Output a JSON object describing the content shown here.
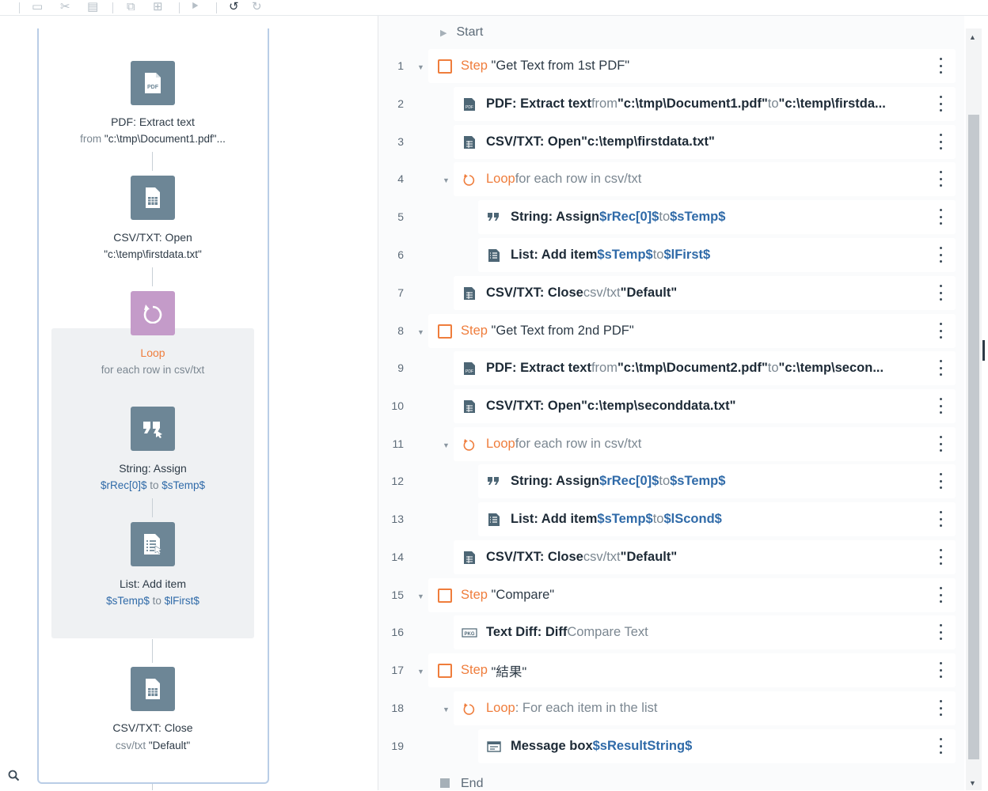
{
  "toolbar": {
    "icons": [
      "new-icon",
      "cut-icon",
      "delete-icon",
      "copy-icon",
      "paste-icon",
      "run-icon",
      "undo-icon",
      "redo-icon"
    ]
  },
  "flow": {
    "nodes": [
      {
        "id": "pdf",
        "icon": "pdf-icon",
        "title": "PDF: Extract text",
        "sub_prefix": "from ",
        "sub_value": "\"c:\\tmp\\Document1.pdf\"..."
      },
      {
        "id": "csv-open",
        "icon": "file-icon",
        "title": "CSV/TXT: Open",
        "sub_value": "\"c:\\temp\\firstdata.txt\""
      },
      {
        "id": "loop",
        "icon": "loop-icon",
        "title": "Loop",
        "sub": "for each row in csv/txt"
      },
      {
        "id": "string-assign",
        "icon": "quote-icon",
        "title": "String: Assign",
        "sub_a": "$rRec[0]$",
        "sub_to": " to ",
        "sub_b": "$sTemp$"
      },
      {
        "id": "list-add",
        "icon": "list-icon",
        "title": "List: Add item",
        "sub_a": "$sTemp$",
        "sub_to": " to ",
        "sub_b": "$lFirst$"
      },
      {
        "id": "csv-close",
        "icon": "file-icon",
        "title": "CSV/TXT: Close",
        "sub_prefix": "csv/txt ",
        "sub_value": "\"Default\""
      }
    ]
  },
  "list": {
    "start_label": "Start",
    "end_label": "End",
    "rows": [
      {
        "n": "1",
        "kw": "Step",
        "text": "\"Get Text from 1st PDF\""
      },
      {
        "n": "2",
        "kw": "PDF: Extract text",
        "from": " from ",
        "src": "\"c:\\tmp\\Document1.pdf\"",
        "to": " to ",
        "dst": "\"c:\\temp\\firstda..."
      },
      {
        "n": "3",
        "kw": "CSV/TXT: Open",
        "src": " \"c:\\temp\\firstdata.txt\""
      },
      {
        "n": "4",
        "kw": "Loop",
        "text": " for each row in csv/txt"
      },
      {
        "n": "5",
        "kw": "String: Assign",
        "a": " $rRec[0]$",
        "to": " to ",
        "b": "$sTemp$"
      },
      {
        "n": "6",
        "kw": "List: Add item",
        "a": " $sTemp$",
        "to": " to ",
        "b": "$lFirst$"
      },
      {
        "n": "7",
        "kw": "CSV/TXT: Close",
        "mid": " csv/txt ",
        "val": "\"Default\""
      },
      {
        "n": "8",
        "kw": "Step",
        "text": "\"Get Text from 2nd PDF\""
      },
      {
        "n": "9",
        "kw": "PDF: Extract text",
        "from": " from ",
        "src": "\"c:\\tmp\\Document2.pdf\"",
        "to": " to ",
        "dst": "\"c:\\temp\\secon..."
      },
      {
        "n": "10",
        "kw": "CSV/TXT: Open",
        "src": " \"c:\\temp\\seconddata.txt\""
      },
      {
        "n": "11",
        "kw": "Loop",
        "text": " for each row in csv/txt"
      },
      {
        "n": "12",
        "kw": "String: Assign",
        "a": " $rRec[0]$",
        "to": " to ",
        "b": "$sTemp$"
      },
      {
        "n": "13",
        "kw": "List: Add item",
        "a": " $sTemp$",
        "to": " to ",
        "b": "$lScond$"
      },
      {
        "n": "14",
        "kw": "CSV/TXT: Close",
        "mid": " csv/txt ",
        "val": "\"Default\""
      },
      {
        "n": "15",
        "kw": "Step",
        "text": "\"Compare\""
      },
      {
        "n": "16",
        "kw": "Text Diff: Diff",
        "text": " Compare Text"
      },
      {
        "n": "17",
        "kw": "Step",
        "text": "\"結果\""
      },
      {
        "n": "18",
        "kw": "Loop",
        "text": " : For each item in the list"
      },
      {
        "n": "19",
        "kw": "Message box",
        "a": " $sResultString$"
      }
    ]
  },
  "colors": {
    "accent": "#ef7d3c",
    "variable": "#2f6aa8",
    "node": "#6d8696",
    "loop_node": "#c49bc9"
  }
}
